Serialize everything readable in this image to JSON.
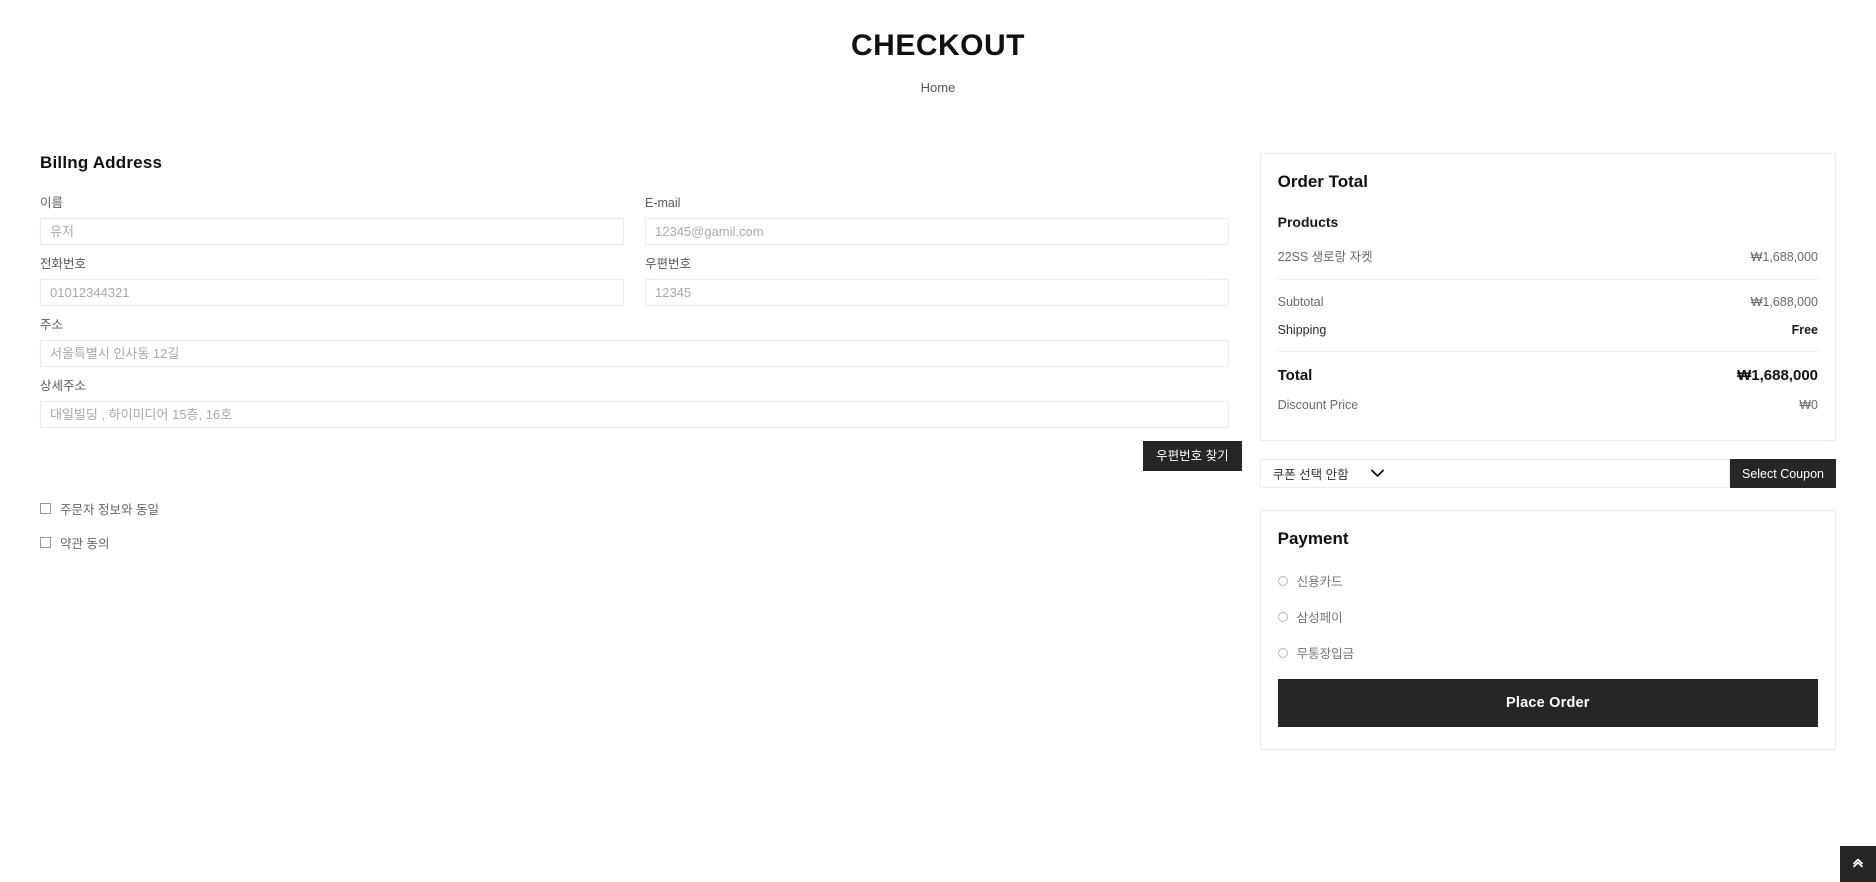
{
  "header": {
    "title": "CHECKOUT",
    "breadcrumb": "Home"
  },
  "billing": {
    "section_title": "Billng Address",
    "fields": [
      {
        "label": "이름",
        "placeholder": "유저",
        "value": ""
      },
      {
        "label": "E-mail",
        "placeholder": "12345@gamil.com",
        "value": ""
      },
      {
        "label": "전화번호",
        "placeholder": "01012344321",
        "value": ""
      },
      {
        "label": "우편번호",
        "placeholder": "12345",
        "value": ""
      },
      {
        "label": "주소",
        "placeholder": "서울특별시 인사동 12길",
        "value": ""
      },
      {
        "label": "상세주소",
        "placeholder": "대일빌딩 , 하이미디어 15층, 16호",
        "value": ""
      }
    ],
    "postal_button": "우편번호 찾기",
    "checkboxes": [
      {
        "label": "주문자 정보와 동일",
        "checked": false
      },
      {
        "label": "약관 동의",
        "checked": false
      }
    ]
  },
  "order_total": {
    "title": "Order Total",
    "products_heading": "Products",
    "products": [
      {
        "name": "22SS 생로랑 자켓",
        "price": "₩1,688,000"
      }
    ],
    "subtotal_label": "Subtotal",
    "subtotal_value": "₩1,688,000",
    "shipping_label": "Shipping",
    "shipping_value": "Free",
    "total_label": "Total",
    "total_value": "₩1,688,000",
    "discount_label": "Discount Price",
    "discount_value": "₩0"
  },
  "coupon": {
    "selected": "쿠폰 선택 안함",
    "options": [
      "쿠폰 선택 안함"
    ],
    "button_label": "Select Coupon"
  },
  "payment": {
    "title": "Payment",
    "methods": [
      {
        "label": "신용카드",
        "selected": false
      },
      {
        "label": "삼성페이",
        "selected": false
      },
      {
        "label": "무통장입금",
        "selected": false
      }
    ],
    "place_order_label": "Place Order"
  },
  "icons": {
    "chevron_down": "chevron-down-icon",
    "scroll_top": "double-chevron-up-icon"
  },
  "colors": {
    "accent_dark": "#262626",
    "border": "#e6ecf3",
    "text_muted": "#6a6a6a"
  }
}
